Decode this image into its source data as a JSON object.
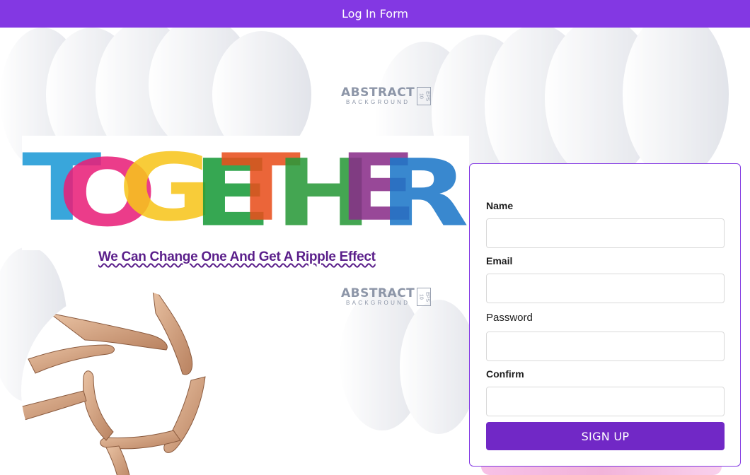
{
  "header": {
    "title": "Log In Form"
  },
  "background": {
    "brand_main": "ABSTRACT",
    "brand_sub": "BACKGROUND",
    "brand_eps": "EPS 10"
  },
  "hero": {
    "headline": "TOGETHER",
    "tagline": "We Can Change One And Get A Ripple Effect"
  },
  "form": {
    "fields": [
      {
        "label": "Name",
        "value": "",
        "placeholder": ""
      },
      {
        "label": "Email",
        "value": "",
        "placeholder": ""
      },
      {
        "label": "Password",
        "value": "",
        "placeholder": ""
      },
      {
        "label": "Confirm",
        "value": "",
        "placeholder": ""
      }
    ],
    "submit_label": "SIGN UP"
  },
  "colors": {
    "accent": "#8338e3",
    "button": "#7128c6",
    "tagline": "#5a1e8a"
  }
}
